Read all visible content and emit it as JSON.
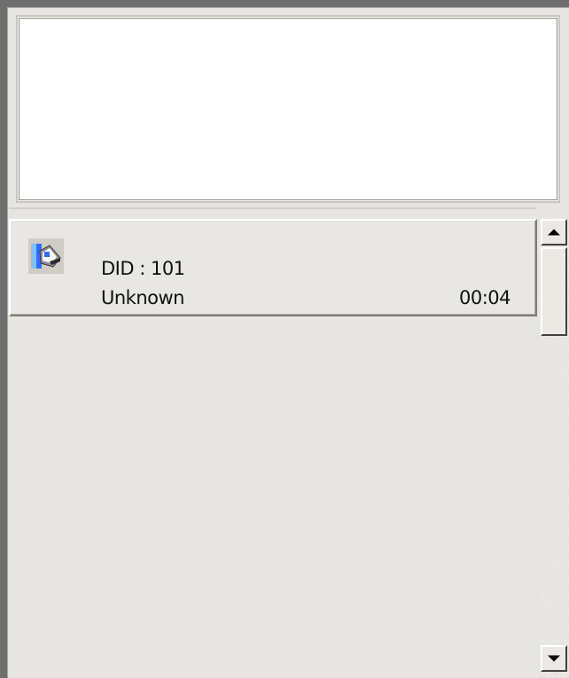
{
  "call_list": {
    "items": [
      {
        "did": "DID : 101",
        "caller": "Unknown",
        "duration": "00:04",
        "icon": "phone-handset-icon"
      }
    ]
  },
  "scrollbar": {
    "up_icon": "arrow-up-icon",
    "down_icon": "arrow-down-icon"
  },
  "colors": {
    "panel_bg": "#e7e5e1",
    "preview_bg": "#ffffff",
    "icon_blue": "#2f6cff"
  }
}
